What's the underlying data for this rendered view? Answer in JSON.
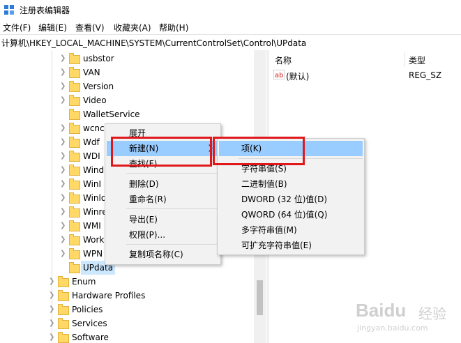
{
  "window": {
    "title": "注册表编辑器"
  },
  "menu": [
    "文件(F)",
    "编辑(E)",
    "查看(V)",
    "收藏夹(A)",
    "帮助(H)"
  ],
  "address": "计算机\\HKEY_LOCAL_MACHINE\\SYSTEM\\CurrentControlSet\\Control\\UPdata",
  "tree": {
    "items": [
      {
        "label": "usbstor"
      },
      {
        "label": "VAN"
      },
      {
        "label": "Version"
      },
      {
        "label": "Video"
      },
      {
        "label": "WalletService"
      },
      {
        "label": "wcncs"
      },
      {
        "label": "Wdf"
      },
      {
        "label": "WDI"
      },
      {
        "label": "Wind"
      },
      {
        "label": "WinI"
      },
      {
        "label": "Winlo"
      },
      {
        "label": "Winre"
      },
      {
        "label": "WMI"
      },
      {
        "label": "Work"
      },
      {
        "label": "WPN"
      },
      {
        "label": "UPdata"
      },
      {
        "label": "Enum"
      },
      {
        "label": "Hardware Profiles"
      },
      {
        "label": "Policies"
      },
      {
        "label": "Services"
      },
      {
        "label": "Software"
      }
    ]
  },
  "list": {
    "headers": {
      "name": "名称",
      "type": "类型"
    },
    "rows": [
      {
        "name": "(默认)",
        "type": "REG_SZ"
      }
    ]
  },
  "context_menu": {
    "items": [
      "展开",
      "新建(N)",
      "查找(F)...",
      "删除(D)",
      "重命名(R)",
      "导出(E)",
      "权限(P)...",
      "复制项名称(C)"
    ]
  },
  "submenu": {
    "items": [
      "项(K)",
      "字符串值(S)",
      "二进制值(B)",
      "DWORD (32 位)值(D)",
      "QWORD (64 位)值(Q)",
      "多字符串值(M)",
      "可扩充字符串值(E)"
    ]
  },
  "watermark": {
    "brand": "Baidu",
    "brand_cn": "经验",
    "url": "jingyan.baidu.com"
  }
}
